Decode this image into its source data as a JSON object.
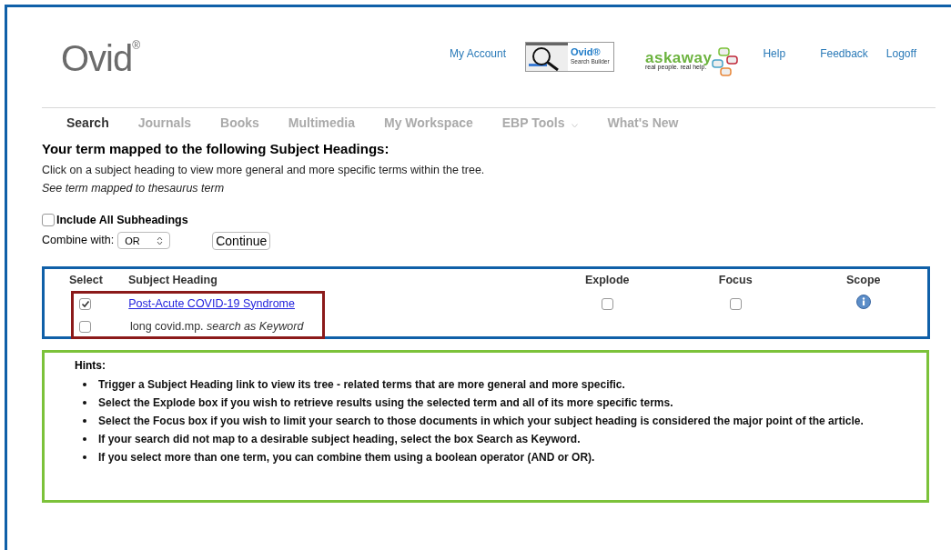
{
  "header": {
    "logo": "Ovid",
    "logo_mark": "®",
    "links": [
      {
        "label": "My Account"
      },
      {
        "label": "Help"
      },
      {
        "label": "Feedback"
      },
      {
        "label": "Logoff"
      }
    ],
    "search_builder": {
      "title": "Ovid®",
      "subtitle": "Search Builder"
    },
    "askaway": {
      "title": "askaway",
      "tagline": "real people. real help."
    }
  },
  "nav": [
    {
      "label": "Search",
      "selected": true
    },
    {
      "label": "Journals",
      "selected": false
    },
    {
      "label": "Books",
      "selected": false
    },
    {
      "label": "Multimedia",
      "selected": false
    },
    {
      "label": "My Workspace",
      "selected": false
    },
    {
      "label": "EBP Tools",
      "selected": false,
      "dropdown": true
    },
    {
      "label": "What's New",
      "selected": false
    }
  ],
  "title": "Your term mapped to the following Subject Headings:",
  "instruction": "Click on a subject heading to view more general and more specific terms within the tree.",
  "note": "See term mapped to thesaurus term",
  "include_subheadings": {
    "label": "Include All Subheadings",
    "checked": false
  },
  "combine": {
    "label": "Combine with:",
    "value": "OR"
  },
  "continue_button": "Continue",
  "table": {
    "columns": [
      "Select",
      "Subject Heading",
      "Explode",
      "Focus",
      "Scope"
    ],
    "rows": [
      {
        "kind": "heading",
        "selected": true,
        "text": "Post-Acute COVID-19 Syndrome",
        "explode": false,
        "focus": false,
        "scope": true
      },
      {
        "kind": "keyword",
        "selected": false,
        "text": "long covid.mp. *search as Keyword*"
      }
    ]
  },
  "hints": {
    "title": "Hints:",
    "items": [
      "Trigger a Subject Heading link to view its tree - related terms that are more general and more specific.",
      "Select the Explode box if you wish to retrieve results using the selected term and all of its more specific terms.",
      "Select the Focus box if you wish to limit your search to those documents in which your subject heading is considered the major point of the article.",
      "If your search did not map to a desirable subject heading, select the box Search as Keyword.",
      "If you select more than one term, you can combine them using a boolean operator (AND or OR)."
    ]
  }
}
